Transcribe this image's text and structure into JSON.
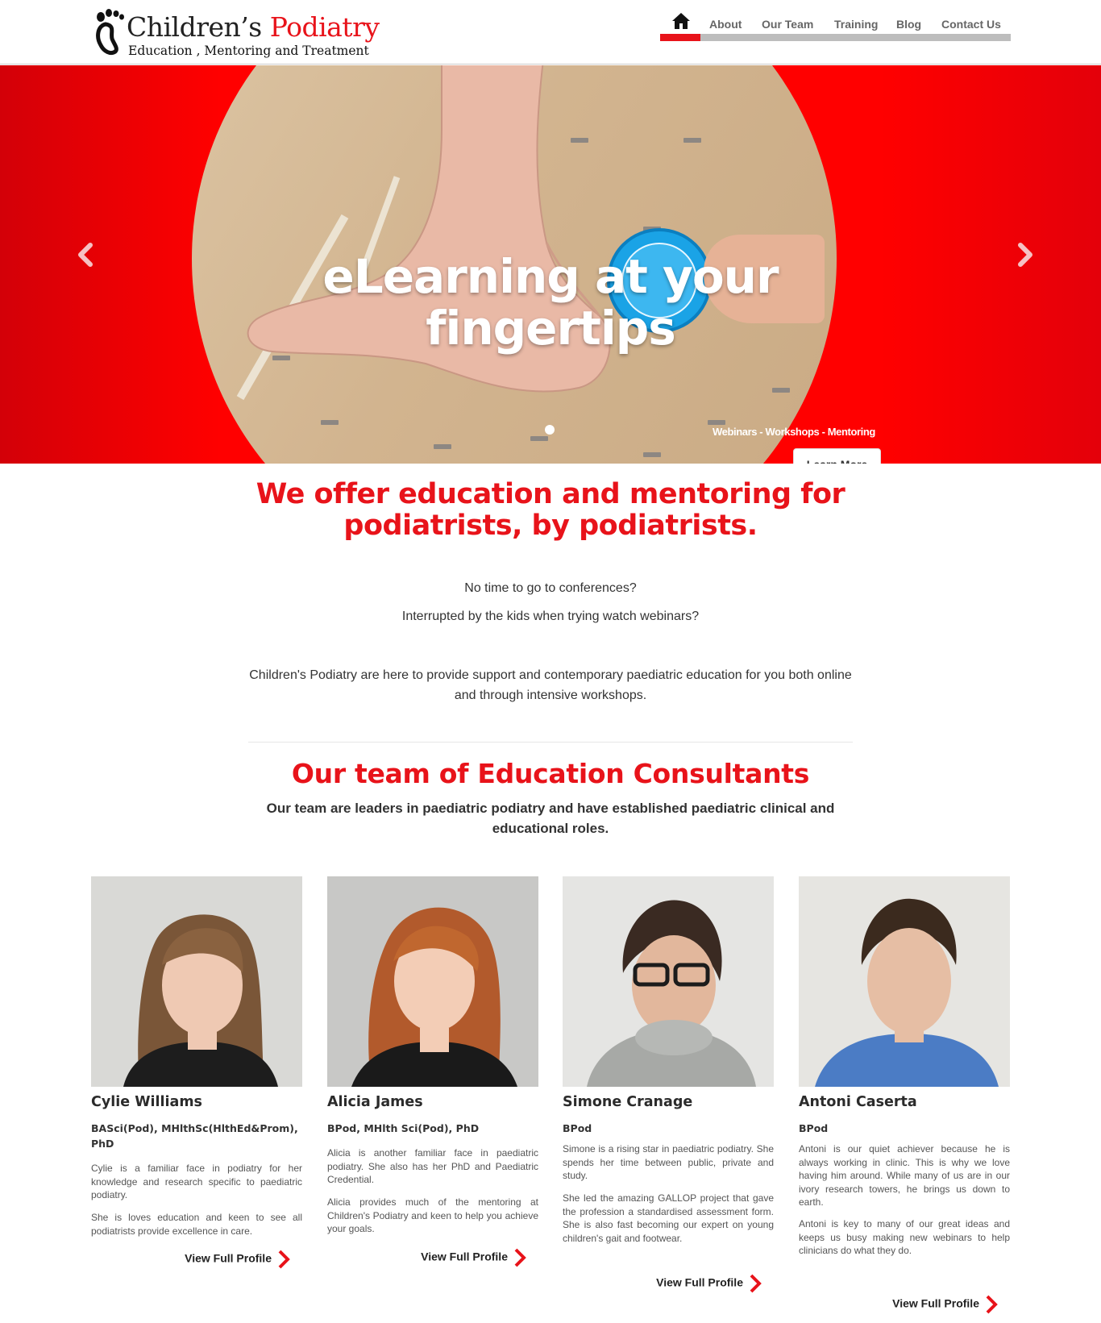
{
  "brand": {
    "title_main": "Children’s ",
    "title_accent": "Podiatry",
    "subtitle": "Education , Mentoring and Treatment"
  },
  "nav": {
    "home_icon": "home-icon",
    "items": [
      "About",
      "Our Team",
      "Training",
      "Blog",
      "Contact Us"
    ],
    "active_color": "#e8131a",
    "bar_color": "#bdbdbd"
  },
  "hero": {
    "title": "eLearning at your fingertips",
    "subtitle_parts": [
      "Webinars",
      " - ",
      "Workshops",
      " - ",
      "Mentoring"
    ],
    "button_label": "Learn More",
    "prev_icon": "chevron-left-icon",
    "next_icon": "chevron-right-icon",
    "background_color": "#ff0000"
  },
  "intro": {
    "headline": "We offer education and mentoring for podiatrists, by podiatrists.",
    "question_1": "No time to go to conferences?",
    "question_2": "Interrupted by the kids when trying watch webinars?",
    "paragraph": "Children's Podiatry are here to provide support and contemporary paediatric education for you both online and through intensive workshops."
  },
  "team": {
    "title": "Our team of Education Consultants",
    "subtitle": "Our team are leaders in paediatric podiatry and have established paediatric clinical and educational roles.",
    "link_label": "View Full Profile",
    "members": [
      {
        "name": "Cylie Williams",
        "credentials": "BASci(Pod), MHlthSc(HlthEd&Prom), PhD",
        "bio_1": "Cylie is a familiar face in podiatry for her knowledge and research specific to paediatric podiatry.",
        "bio_2": "She is loves education and keen to see all podiatrists provide excellence in care."
      },
      {
        "name": "Alicia James",
        "credentials": "BPod, MHlth Sci(Pod), PhD",
        "bio_1": "Alicia is another familiar face in paediatric podiatry. She also has her PhD and Paediatric Credential.",
        "bio_2": "Alicia provides much of the mentoring at Children's Podiatry and keen to help you achieve your goals."
      },
      {
        "name": "Simone Cranage",
        "credentials": "BPod",
        "bio_1": "Simone is a rising star in paediatric podiatry. She spends her time between public, private and study.",
        "bio_2": "She led the amazing GALLOP project that gave the profession a standardised assessment form. She is also fast becoming our expert on young children's gait and footwear."
      },
      {
        "name": "Antoni Caserta",
        "credentials": "BPod",
        "bio_1": "Antoni is our quiet achiever because he is always working in clinic. This is why we love having him around. While many of us are in our ivory research towers, he brings us down to earth.",
        "bio_2": "Antoni is key to many of our great ideas and keeps us busy making new webinars to help clinicians do what they do."
      }
    ]
  }
}
